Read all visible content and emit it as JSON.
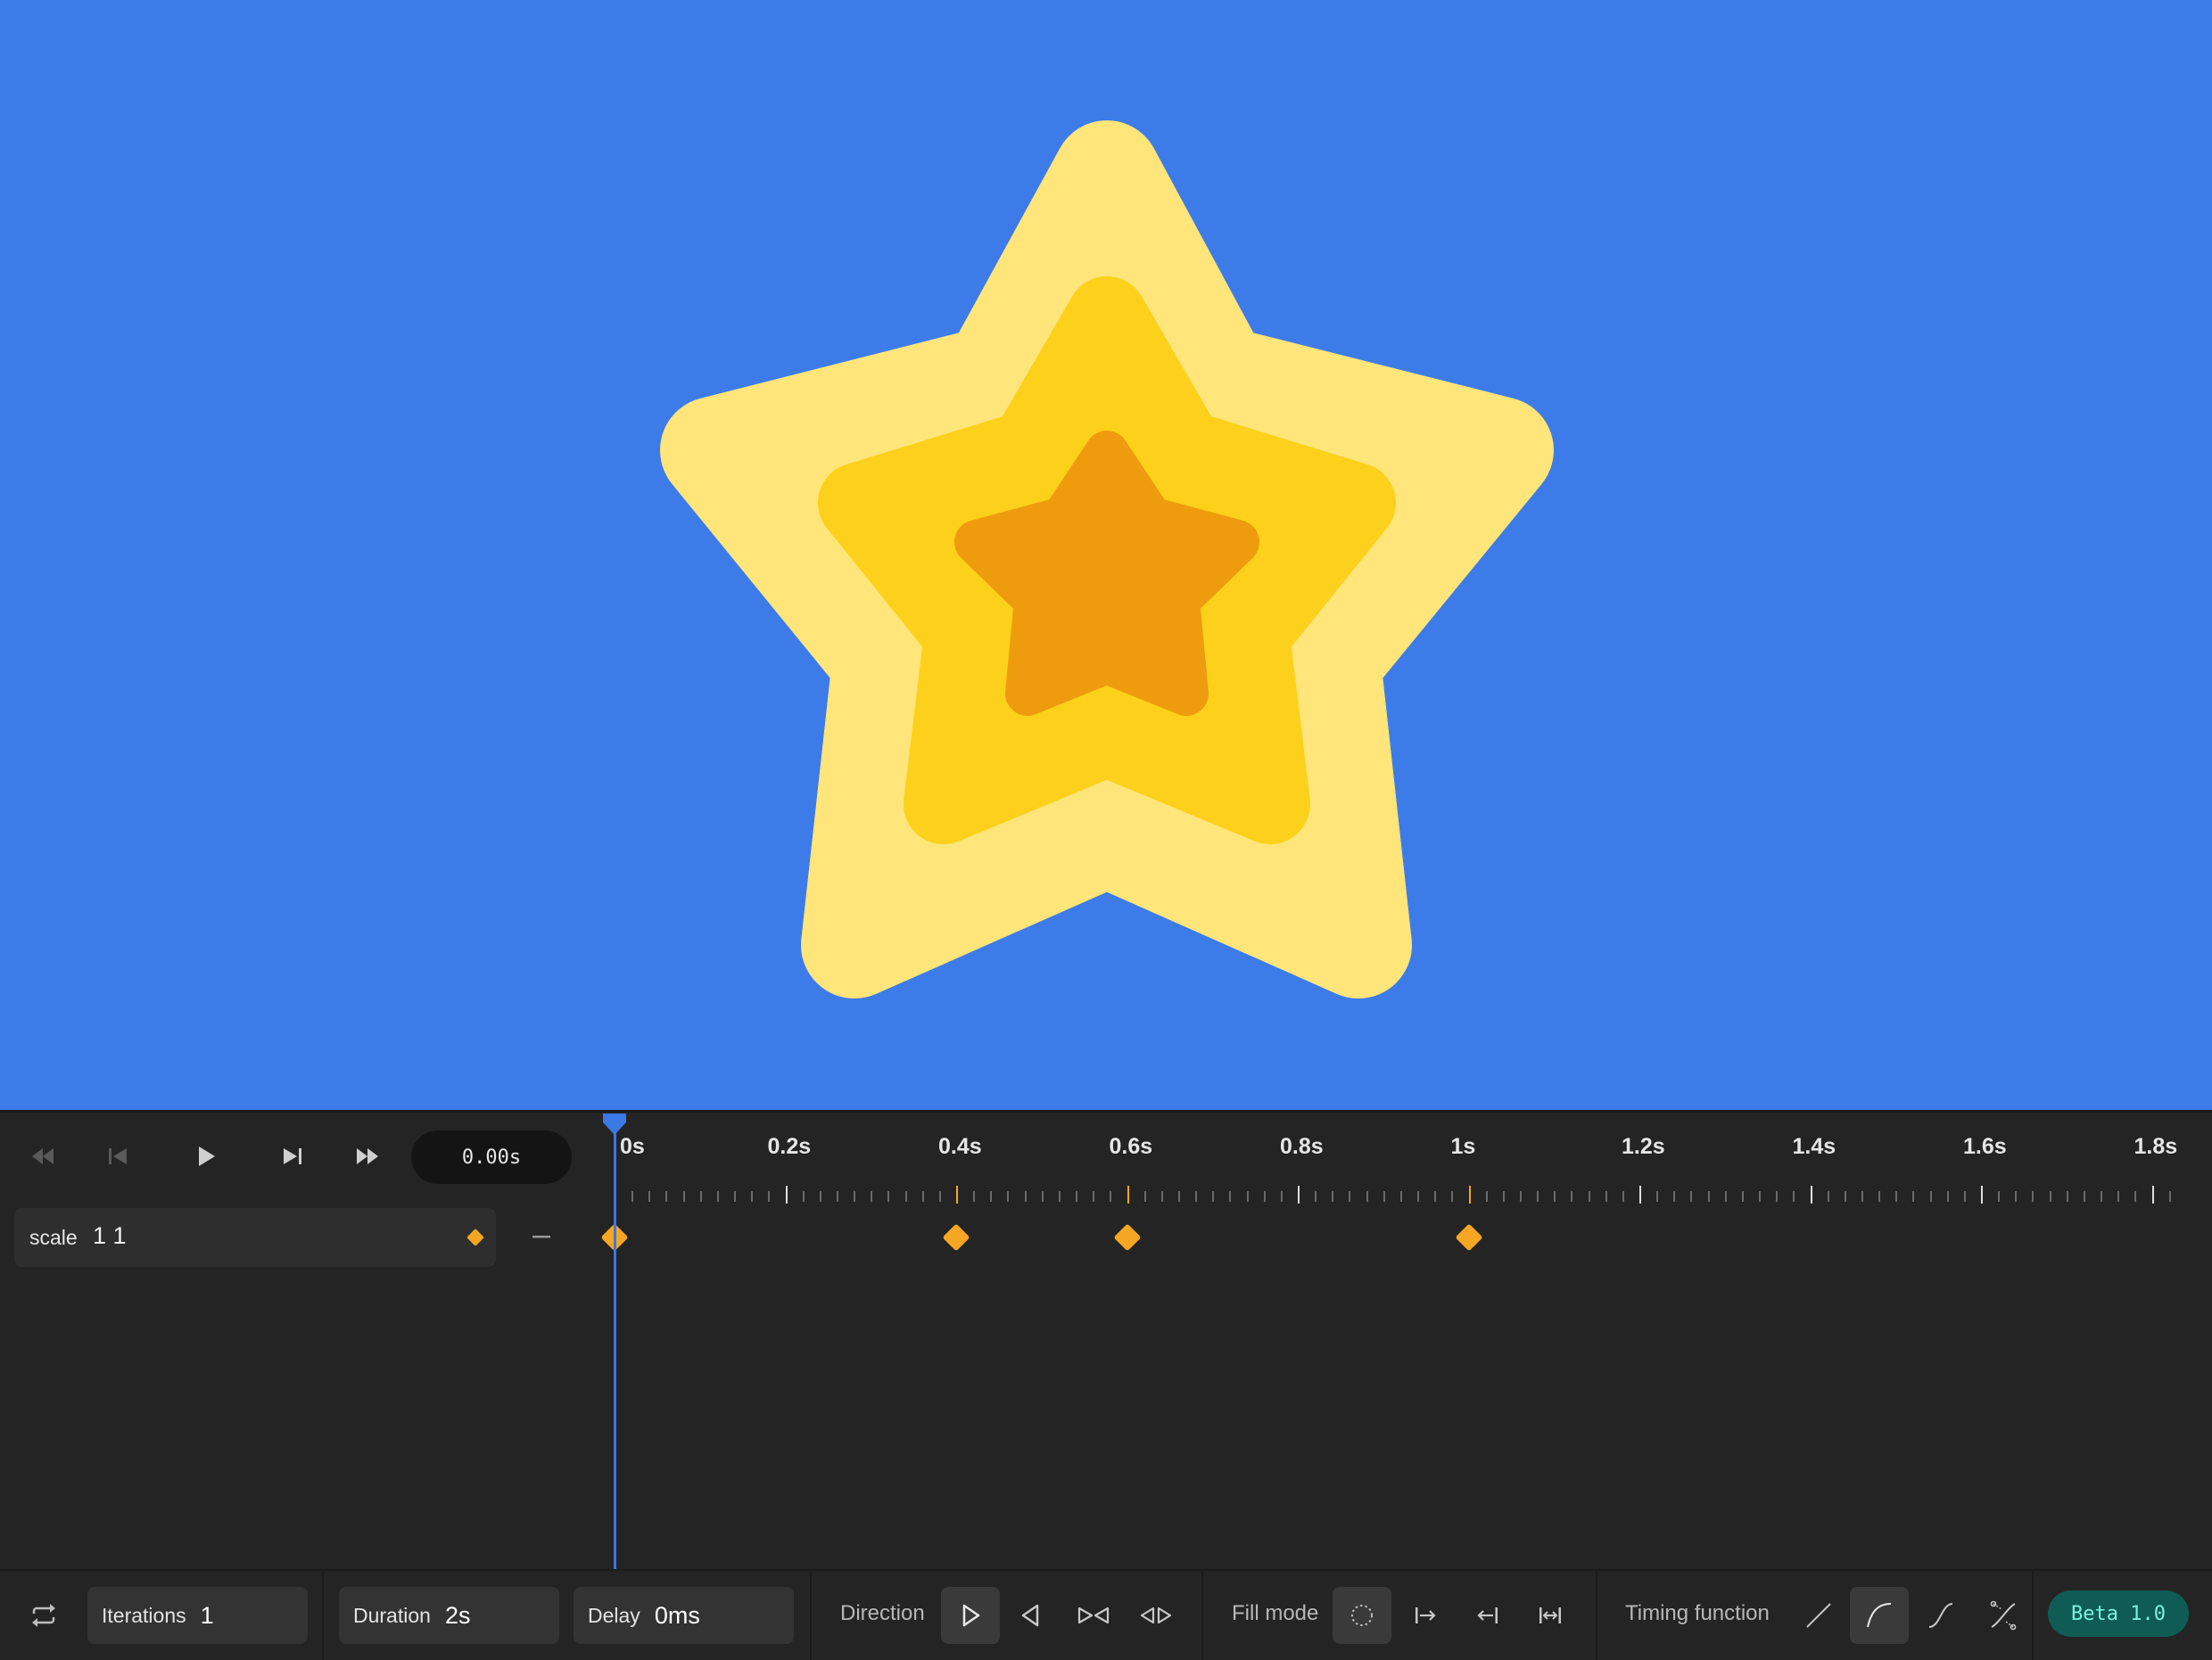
{
  "colors": {
    "canvas_bg": "#3d7ce8",
    "star_outer": "#ffe57a",
    "star_middle": "#fdd11b",
    "star_inner": "#ee9c0d",
    "panel_bg": "#242424",
    "keyframe": "#f5a623",
    "playhead": "#3b79e5",
    "beta_bg": "#0f5c55",
    "beta_text": "#7ff0df"
  },
  "transport": {
    "buttons": [
      {
        "name": "rewind-icon",
        "icon": "double-left-arrow"
      },
      {
        "name": "skip-to-start-icon",
        "icon": "bar-left-triangle"
      },
      {
        "name": "play-icon",
        "icon": "right-triangle"
      },
      {
        "name": "skip-to-end-icon",
        "icon": "right-triangle-bar"
      },
      {
        "name": "fast-forward-icon",
        "icon": "double-right-arrow"
      }
    ],
    "current_time": "0.00s"
  },
  "timeline": {
    "tick_labels": [
      "0s",
      "0.2s",
      "0.4s",
      "0.6s",
      "0.8s",
      "1s",
      "1.2s",
      "1.4s",
      "1.6s",
      "1.8s"
    ],
    "playhead_time_s": 0,
    "keyframe_times_s": [
      0,
      0.4,
      0.6,
      1.0
    ]
  },
  "track": {
    "property": "scale",
    "value": "1 1",
    "keyframe_button_icon": "diamond-icon",
    "remove_icon": "minus-icon"
  },
  "bottombar": {
    "loop_icon": "loop-icon",
    "iterations": {
      "label": "Iterations",
      "value": "1"
    },
    "duration": {
      "label": "Duration",
      "value": "2s"
    },
    "delay": {
      "label": "Delay",
      "value": "0ms"
    },
    "direction": {
      "label": "Direction",
      "options": [
        "normal-icon",
        "reverse-icon",
        "alternate-icon",
        "alternate-reverse-icon"
      ],
      "selected": "normal-icon"
    },
    "fill_mode": {
      "label": "Fill mode",
      "options": [
        "fill-none-icon",
        "fill-forwards-icon",
        "fill-backwards-icon",
        "fill-both-icon"
      ],
      "selected": "fill-none-icon"
    },
    "timing_function": {
      "label": "Timing function",
      "options": [
        "linear-icon",
        "ease-out-icon",
        "ease-in-out-icon",
        "custom-bezier-icon"
      ],
      "selected": "ease-out-icon"
    },
    "version_badge": "Beta 1.0"
  }
}
